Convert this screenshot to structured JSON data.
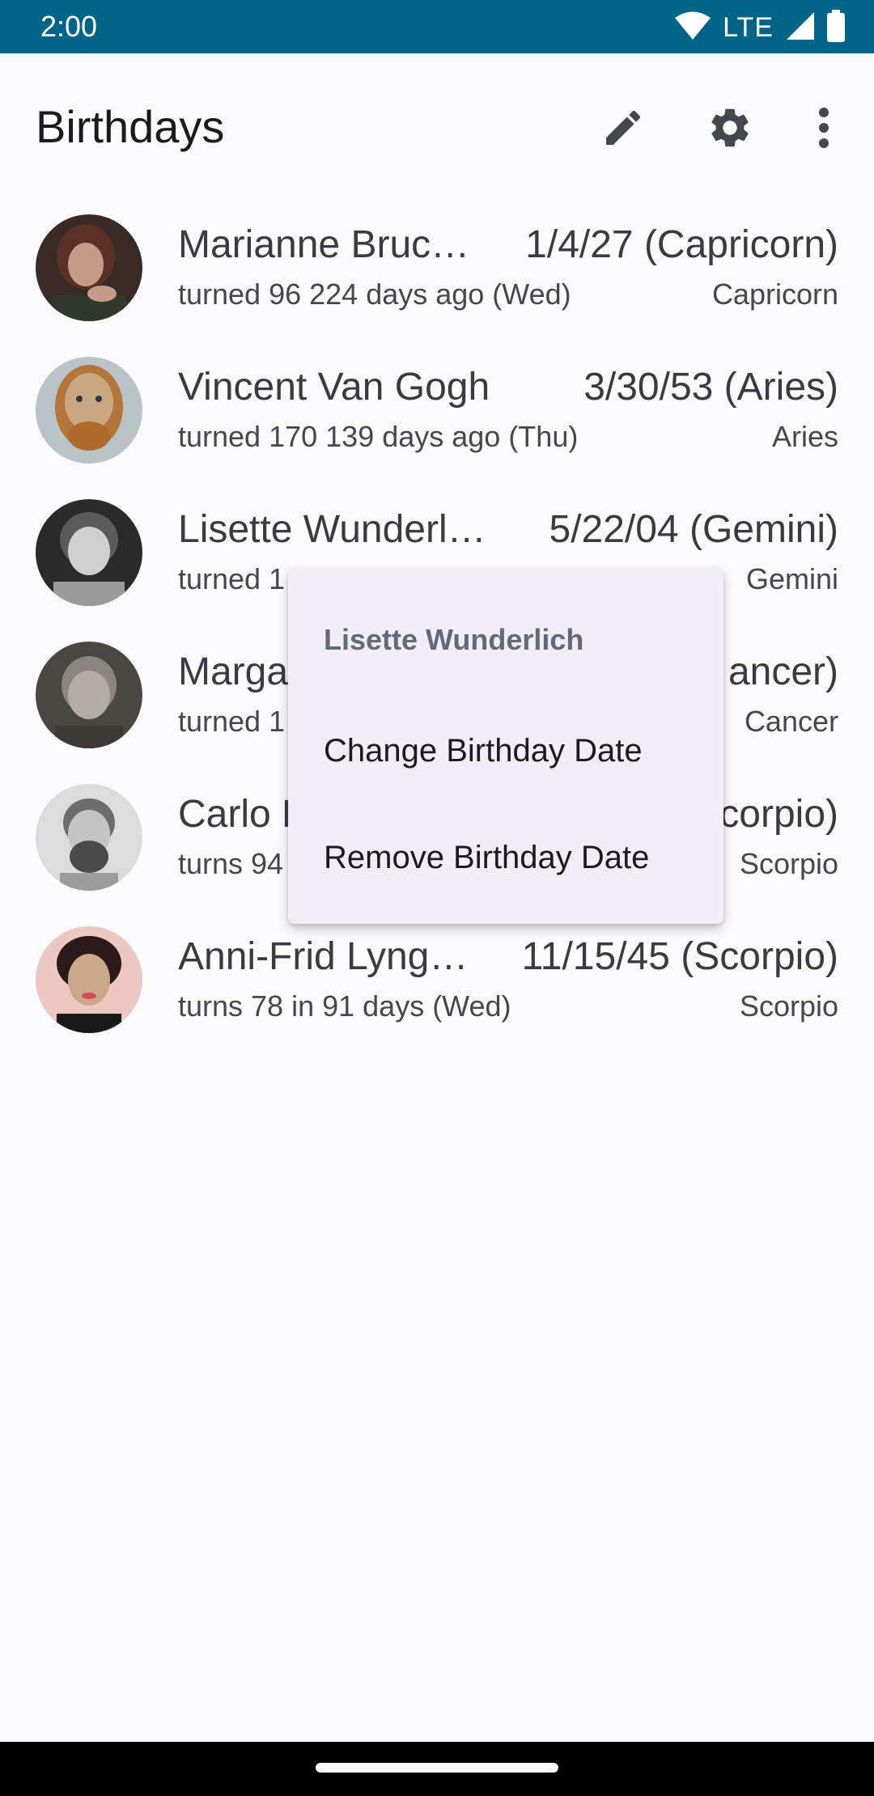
{
  "status_bar": {
    "time": "2:00",
    "network": "LTE",
    "icons": [
      "wifi-icon",
      "signal-icon",
      "battery-icon"
    ],
    "color": "#006489"
  },
  "app_bar": {
    "title": "Birthdays",
    "actions": [
      "edit-icon",
      "settings-icon",
      "more-vert-icon"
    ]
  },
  "birthdays": [
    {
      "name": "Marianne Bruc…",
      "date": "1/4/27 (Capricorn)",
      "detail": "turned 96 224 days ago (Wed)",
      "sign": "Capricorn"
    },
    {
      "name": "Vincent Van Gogh",
      "date": "3/30/53 (Aries)",
      "detail": "turned 170 139 days ago (Thu)",
      "sign": "Aries"
    },
    {
      "name": "Lisette Wunderli…",
      "date": "5/22/04 (Gemini)",
      "detail": "turned 1",
      "sign": "Gemini"
    },
    {
      "name": "Marga",
      "date": "ancer)",
      "detail": "turned 1",
      "sign": "Cancer"
    },
    {
      "name": "Carlo P",
      "date": "corpio)",
      "detail": "turns 94",
      "sign": "Scorpio"
    },
    {
      "name": "Anni-Frid Lyng…",
      "date": "11/15/45 (Scorpio)",
      "detail": "turns 78 in 91 days (Wed)",
      "sign": "Scorpio"
    }
  ],
  "context_menu": {
    "title": "Lisette Wunderlich",
    "items": [
      "Change Birthday Date",
      "Remove Birthday Date"
    ]
  }
}
